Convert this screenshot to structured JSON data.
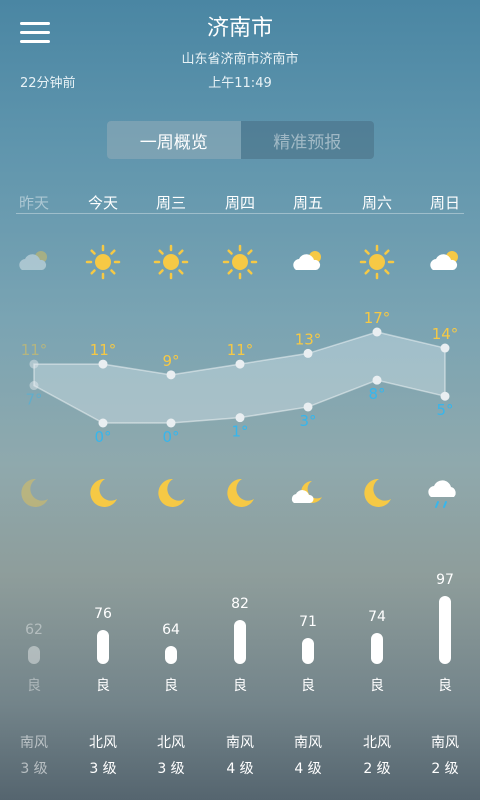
{
  "header": {
    "city": "济南市",
    "address": "山东省济南市济南市",
    "updated_ago": "22分钟前",
    "time": "上午11:49"
  },
  "tabs": [
    {
      "label": "一周概览",
      "active": true
    },
    {
      "label": "精准预报",
      "active": false
    }
  ],
  "days": [
    {
      "label": "昨天",
      "past": true,
      "day_icon": "cloud-sun-icon",
      "night_icon": "moon-icon",
      "high": "11°",
      "low": "7°",
      "aqi": "62",
      "aqi_level": "良",
      "wind_dir": "南风",
      "wind_level": "3 级"
    },
    {
      "label": "今天",
      "past": false,
      "day_icon": "sun-icon",
      "night_icon": "moon-icon",
      "high": "11°",
      "low": "0°",
      "aqi": "76",
      "aqi_level": "良",
      "wind_dir": "北风",
      "wind_level": "3 级"
    },
    {
      "label": "周三",
      "past": false,
      "day_icon": "sun-icon",
      "night_icon": "moon-icon",
      "high": "9°",
      "low": "0°",
      "aqi": "64",
      "aqi_level": "良",
      "wind_dir": "北风",
      "wind_level": "3 级"
    },
    {
      "label": "周四",
      "past": false,
      "day_icon": "sun-icon",
      "night_icon": "moon-icon",
      "high": "11°",
      "low": "1°",
      "aqi": "82",
      "aqi_level": "良",
      "wind_dir": "南风",
      "wind_level": "4 级"
    },
    {
      "label": "周五",
      "past": false,
      "day_icon": "cloud-sun-icon",
      "night_icon": "moon-cloud-icon",
      "high": "13°",
      "low": "3°",
      "aqi": "71",
      "aqi_level": "良",
      "wind_dir": "南风",
      "wind_level": "4 级"
    },
    {
      "label": "周六",
      "past": false,
      "day_icon": "sun-icon",
      "night_icon": "moon-icon",
      "high": "17°",
      "low": "8°",
      "aqi": "74",
      "aqi_level": "良",
      "wind_dir": "北风",
      "wind_level": "2 级"
    },
    {
      "label": "周日",
      "past": false,
      "day_icon": "cloud-sun-icon",
      "night_icon": "rain-cloud-icon",
      "high": "14°",
      "low": "5°",
      "aqi": "97",
      "aqi_level": "良",
      "wind_dir": "南风",
      "wind_level": "2 级"
    }
  ],
  "chart_data": {
    "type": "area",
    "categories": [
      "昨天",
      "今天",
      "周三",
      "周四",
      "周五",
      "周六",
      "周日"
    ],
    "series": [
      {
        "values": [
          11,
          11,
          9,
          11,
          13,
          17,
          14
        ]
      },
      {
        "values": [
          7,
          0,
          0,
          1,
          3,
          8,
          5
        ]
      }
    ],
    "ylim": [
      0,
      17
    ]
  },
  "colors": {
    "high": "#f6c945",
    "low": "#37b6ec",
    "sun": "#f6c945"
  }
}
